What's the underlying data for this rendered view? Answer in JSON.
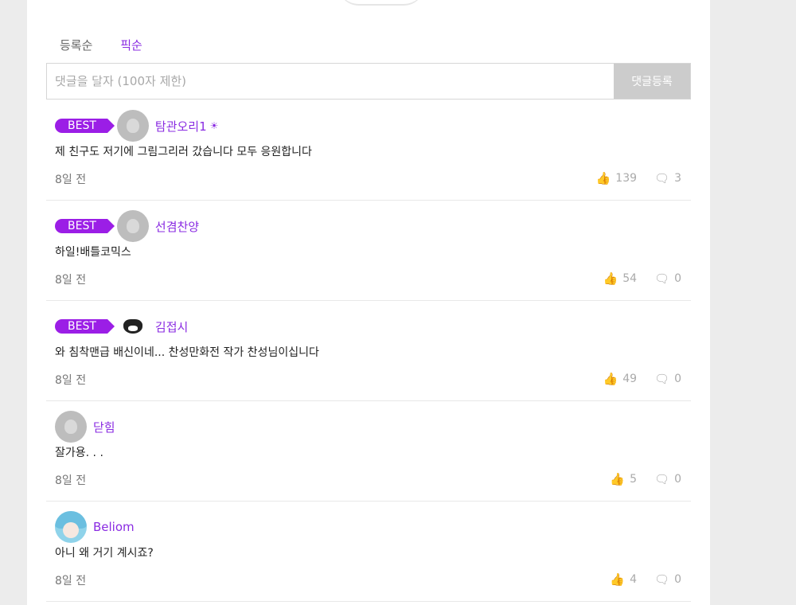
{
  "sort": {
    "tabs": [
      {
        "label": "등록순",
        "active": false
      },
      {
        "label": "픽순",
        "active": true
      }
    ]
  },
  "comment_form": {
    "placeholder": "댓글을 달자 (100자 제한)",
    "submit_label": "댓글등록"
  },
  "comments": [
    {
      "best": true,
      "best_label": "BEST",
      "avatar": "default-duck",
      "username": "탐관오리1",
      "lock_icon": "🔒",
      "body": "제 친구도 저기에 그림그리러 갔습니다 모두 응원합니다",
      "time": "8일 전",
      "likes": "139",
      "replies": "3"
    },
    {
      "best": true,
      "best_label": "BEST",
      "avatar": "default-duck",
      "username": "선겸찬양",
      "body": "하일!배틀코믹스",
      "time": "8일 전",
      "likes": "54",
      "replies": "0"
    },
    {
      "best": true,
      "best_label": "BEST",
      "avatar": "cat",
      "username": "김접시",
      "body": "와 침착맨급 배신이네... 찬성만화전 작가 찬성님이십니다",
      "time": "8일 전",
      "likes": "49",
      "replies": "0"
    },
    {
      "best": false,
      "avatar": "default-duck",
      "username": "닫힘",
      "body": "잘가용. . .",
      "time": "8일 전",
      "likes": "5",
      "replies": "0"
    },
    {
      "best": false,
      "avatar": "anime",
      "username": "Beliom",
      "body": "아니 왜 거기 계시죠?",
      "time": "8일 전",
      "likes": "4",
      "replies": "0"
    }
  ],
  "icons": {
    "like": "thumbs-up-icon",
    "reply": "comment-bubble-icon"
  },
  "colors": {
    "accent": "#8a2be2",
    "best_badge": "#9b1ee6",
    "submit_disabled": "#cccccc"
  }
}
